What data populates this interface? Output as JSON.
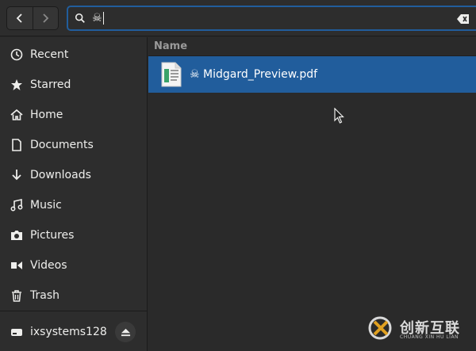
{
  "header": {
    "search": {
      "value": "☠"
    }
  },
  "sidebar": {
    "items": [
      {
        "label": "Recent",
        "icon": "clock-icon"
      },
      {
        "label": "Starred",
        "icon": "star-icon"
      },
      {
        "label": "Home",
        "icon": "home-icon"
      },
      {
        "label": "Documents",
        "icon": "document-icon"
      },
      {
        "label": "Downloads",
        "icon": "download-icon"
      },
      {
        "label": "Music",
        "icon": "music-icon"
      },
      {
        "label": "Pictures",
        "icon": "camera-icon"
      },
      {
        "label": "Videos",
        "icon": "video-icon"
      },
      {
        "label": "Trash",
        "icon": "trash-icon"
      }
    ],
    "devices": [
      {
        "label": "ixsystems128",
        "icon": "drive-icon",
        "action_icon": "eject-icon"
      }
    ]
  },
  "main": {
    "columns": [
      "Name"
    ],
    "files": [
      {
        "name": "☠ Midgard_Preview.pdf",
        "icon": "pdf-document-icon",
        "selected": true
      }
    ]
  },
  "watermark": {
    "text_cn": "创新互联",
    "text_en": "CHUANG XIN HU LIAN"
  },
  "colors": {
    "selection": "#215d9c",
    "background": "#2a2a2a",
    "sidebar": "#2d2d2d",
    "text": "#eeeeec"
  }
}
